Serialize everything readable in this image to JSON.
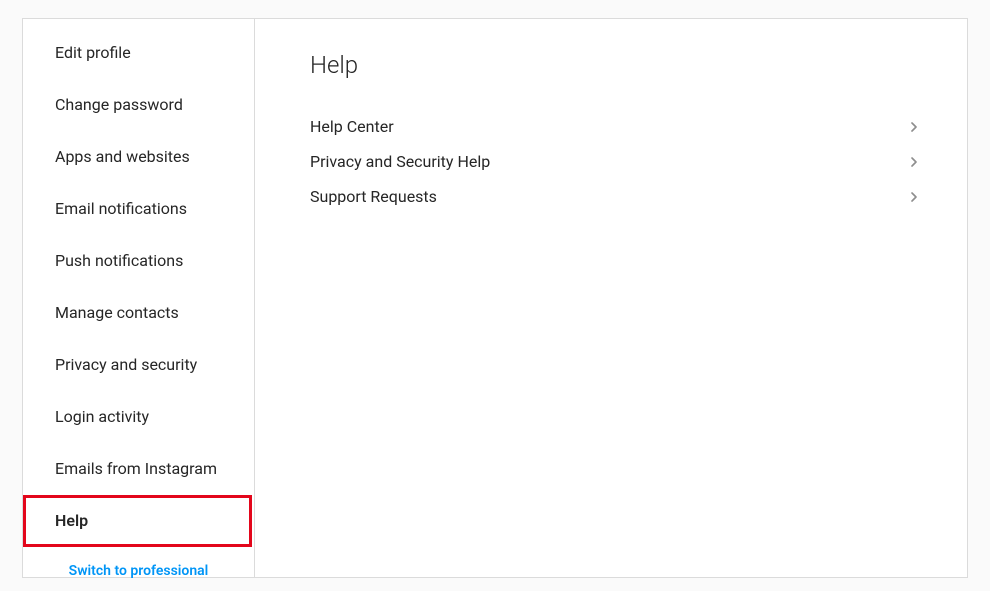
{
  "sidebar": {
    "items": [
      {
        "label": "Edit profile"
      },
      {
        "label": "Change password"
      },
      {
        "label": "Apps and websites"
      },
      {
        "label": "Email notifications"
      },
      {
        "label": "Push notifications"
      },
      {
        "label": "Manage contacts"
      },
      {
        "label": "Privacy and security"
      },
      {
        "label": "Login activity"
      },
      {
        "label": "Emails from Instagram"
      },
      {
        "label": "Help"
      }
    ],
    "switch_label": "Switch to professional"
  },
  "main": {
    "title": "Help",
    "rows": [
      {
        "label": "Help Center"
      },
      {
        "label": "Privacy and Security Help"
      },
      {
        "label": "Support Requests"
      }
    ]
  }
}
